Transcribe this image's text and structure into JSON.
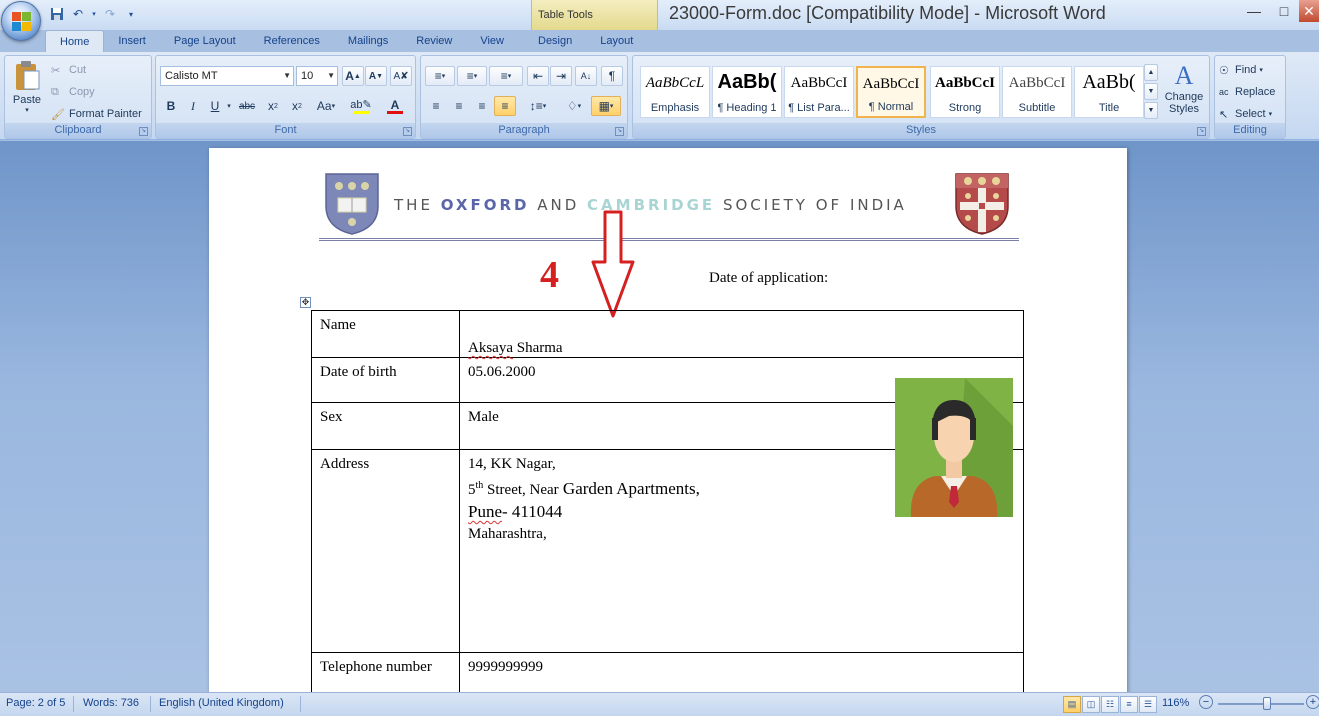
{
  "window": {
    "title": "23000-Form.doc [Compatibility Mode] - Microsoft Word",
    "context_tab_group": "Table Tools"
  },
  "tabs": [
    "Home",
    "Insert",
    "Page Layout",
    "References",
    "Mailings",
    "Review",
    "View",
    "Design",
    "Layout"
  ],
  "active_tab": "Home",
  "ribbon": {
    "clipboard": {
      "label": "Clipboard",
      "paste": "Paste",
      "cut": "Cut",
      "copy": "Copy",
      "format_painter": "Format Painter"
    },
    "font": {
      "label": "Font",
      "family": "Calisto MT",
      "size": "10"
    },
    "paragraph": {
      "label": "Paragraph"
    },
    "styles": {
      "label": "Styles",
      "items": [
        {
          "sample": "AaBbCcL",
          "name": "Emphasis"
        },
        {
          "sample": "AaBb(",
          "name": "¶ Heading 1"
        },
        {
          "sample": "AaBbCcI",
          "name": "¶ List Para..."
        },
        {
          "sample": "AaBbCcI",
          "name": "¶ Normal"
        },
        {
          "sample": "AaBbCcI",
          "name": "Strong"
        },
        {
          "sample": "AaBbCcI",
          "name": "Subtitle"
        },
        {
          "sample": "AaBb(",
          "name": "Title"
        }
      ],
      "selected": "¶ Normal",
      "change_styles": "Change Styles"
    },
    "editing": {
      "label": "Editing",
      "find": "Find",
      "replace": "Replace",
      "select": "Select"
    }
  },
  "document": {
    "org_name_the": "THE ",
    "org_name_oxford": "OXFORD",
    "org_name_and": " AND ",
    "org_name_cambridge": "CAMBRIDGE",
    "org_name_rest": " SOCIETY OF INDIA",
    "annotation_number": "4",
    "date_of_application_label": "Date of application:",
    "rows": {
      "name": {
        "label": "Name",
        "value": "Aksaya Sharma",
        "value_first": "Aksaya",
        "value_rest": " Sharma"
      },
      "dob": {
        "label": "Date of birth",
        "value": "05.06.2000"
      },
      "sex": {
        "label": "Sex",
        "value": "Male"
      },
      "address": {
        "label": "Address",
        "line1": "14, KK Nagar,",
        "line2_num": "5",
        "line2_sup": "th",
        "line2_rest": " Street, Near",
        "line2_big": " Garden Apartments,",
        "line3_first": "Pune",
        "line3_rest": "- 411044",
        "line4": "Maharashtra,"
      },
      "telephone": {
        "label": "Telephone number",
        "value": "9999999999"
      }
    }
  },
  "status": {
    "page": "Page: 2 of 5",
    "words": "Words: 736",
    "language": "English (United Kingdom)",
    "zoom": "116%"
  }
}
